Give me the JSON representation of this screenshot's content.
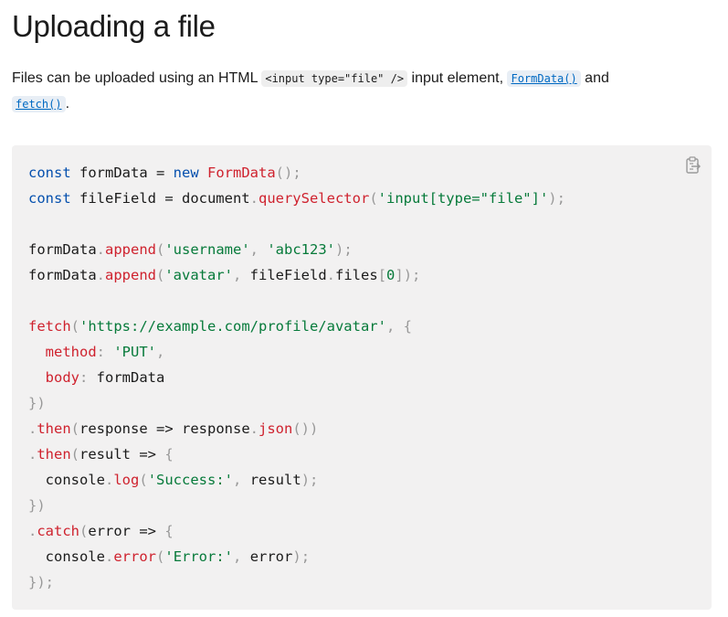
{
  "heading": "Uploading a file",
  "intro": {
    "text1": "Files can be uploaded using an HTML ",
    "code_input": "<input type=\"file\" />",
    "text2": " input element, ",
    "link_formdata": "FormData()",
    "text3": " and",
    "link_fetch": "fetch()",
    "text4": "."
  },
  "code": {
    "copy_icon": "clipboard-icon",
    "lines": [
      [
        [
          "kw",
          "const"
        ],
        [
          "p",
          " formData = "
        ],
        [
          "kw",
          "new"
        ],
        [
          "p",
          " "
        ],
        [
          "fn",
          "FormData"
        ],
        [
          "pn",
          "();"
        ]
      ],
      [
        [
          "kw",
          "const"
        ],
        [
          "p",
          " fileField = document"
        ],
        [
          "pn",
          "."
        ],
        [
          "fn",
          "querySelector"
        ],
        [
          "pn",
          "("
        ],
        [
          "str",
          "'input[type=\"file\"]'"
        ],
        [
          "pn",
          ");"
        ]
      ],
      [],
      [
        [
          "p",
          "formData"
        ],
        [
          "pn",
          "."
        ],
        [
          "fn",
          "append"
        ],
        [
          "pn",
          "("
        ],
        [
          "str",
          "'username'"
        ],
        [
          "pn",
          ", "
        ],
        [
          "str",
          "'abc123'"
        ],
        [
          "pn",
          ");"
        ]
      ],
      [
        [
          "p",
          "formData"
        ],
        [
          "pn",
          "."
        ],
        [
          "fn",
          "append"
        ],
        [
          "pn",
          "("
        ],
        [
          "str",
          "'avatar'"
        ],
        [
          "pn",
          ", "
        ],
        [
          "p",
          "fileField"
        ],
        [
          "pn",
          "."
        ],
        [
          "p",
          "files"
        ],
        [
          "pn",
          "["
        ],
        [
          "num",
          "0"
        ],
        [
          "pn",
          "]);"
        ]
      ],
      [],
      [
        [
          "fn",
          "fetch"
        ],
        [
          "pn",
          "("
        ],
        [
          "str",
          "'https://example.com/profile/avatar'"
        ],
        [
          "pn",
          ", {"
        ]
      ],
      [
        [
          "p",
          "  "
        ],
        [
          "fn",
          "method"
        ],
        [
          "pn",
          ": "
        ],
        [
          "str",
          "'PUT'"
        ],
        [
          "pn",
          ","
        ]
      ],
      [
        [
          "p",
          "  "
        ],
        [
          "fn",
          "body"
        ],
        [
          "pn",
          ": "
        ],
        [
          "p",
          "formData"
        ]
      ],
      [
        [
          "pn",
          "})"
        ]
      ],
      [
        [
          "pn",
          "."
        ],
        [
          "fn",
          "then"
        ],
        [
          "pn",
          "("
        ],
        [
          "p",
          "response => response"
        ],
        [
          "pn",
          "."
        ],
        [
          "fn",
          "json"
        ],
        [
          "pn",
          "())"
        ]
      ],
      [
        [
          "pn",
          "."
        ],
        [
          "fn",
          "then"
        ],
        [
          "pn",
          "("
        ],
        [
          "p",
          "result => "
        ],
        [
          "pn",
          "{"
        ]
      ],
      [
        [
          "p",
          "  console"
        ],
        [
          "pn",
          "."
        ],
        [
          "fn",
          "log"
        ],
        [
          "pn",
          "("
        ],
        [
          "str",
          "'Success:'"
        ],
        [
          "pn",
          ", "
        ],
        [
          "p",
          "result"
        ],
        [
          "pn",
          ");"
        ]
      ],
      [
        [
          "pn",
          "})"
        ]
      ],
      [
        [
          "pn",
          "."
        ],
        [
          "fn",
          "catch"
        ],
        [
          "pn",
          "("
        ],
        [
          "p",
          "error => "
        ],
        [
          "pn",
          "{"
        ]
      ],
      [
        [
          "p",
          "  console"
        ],
        [
          "pn",
          "."
        ],
        [
          "fn",
          "error"
        ],
        [
          "pn",
          "("
        ],
        [
          "str",
          "'Error:'"
        ],
        [
          "pn",
          ", "
        ],
        [
          "p",
          "error"
        ],
        [
          "pn",
          ");"
        ]
      ],
      [
        [
          "pn",
          "});"
        ]
      ]
    ]
  }
}
